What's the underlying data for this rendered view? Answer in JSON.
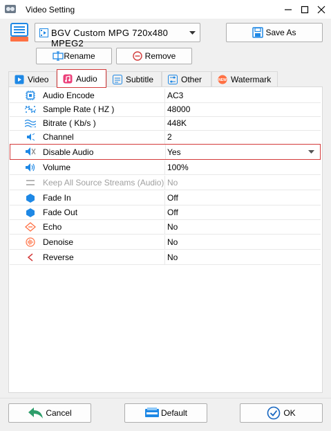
{
  "window": {
    "title": "Video Setting"
  },
  "preset": {
    "selected": "BGV Custom MPG 720x480 MPEG2"
  },
  "buttons": {
    "save_as": "Save As",
    "rename": "Rename",
    "remove": "Remove",
    "cancel": "Cancel",
    "default": "Default",
    "ok": "OK"
  },
  "tabs": [
    {
      "label": "Video",
      "icon": "video-icon"
    },
    {
      "label": "Audio",
      "icon": "music-note-icon"
    },
    {
      "label": "Subtitle",
      "icon": "subtitle-icon"
    },
    {
      "label": "Other",
      "icon": "sliders-icon"
    },
    {
      "label": "Watermark",
      "icon": "new-badge-icon"
    }
  ],
  "active_tab": "Audio",
  "properties": [
    {
      "name": "Audio Encode",
      "value": "AC3",
      "icon": "chip-icon"
    },
    {
      "name": "Sample Rate ( HZ )",
      "value": "48000",
      "icon": "sample-rate-icon"
    },
    {
      "name": "Bitrate ( Kb/s )",
      "value": "448K",
      "icon": "wave-icon"
    },
    {
      "name": "Channel",
      "value": "2",
      "icon": "channel-icon"
    },
    {
      "name": "Disable Audio",
      "value": "Yes",
      "icon": "speaker-muted-icon",
      "selected": true
    },
    {
      "name": "Volume",
      "value": "100%",
      "icon": "speaker-icon"
    },
    {
      "name": "Keep All Source Streams (Audio)",
      "value": "No",
      "icon": "lines-icon",
      "disabled": true
    },
    {
      "name": "Fade In",
      "value": "Off",
      "icon": "hexagon-icon"
    },
    {
      "name": "Fade Out",
      "value": "Off",
      "icon": "hexagon-icon"
    },
    {
      "name": "Echo",
      "value": "No",
      "icon": "echo-icon"
    },
    {
      "name": "Denoise",
      "value": "No",
      "icon": "denoise-icon"
    },
    {
      "name": "Reverse",
      "value": "No",
      "icon": "reverse-icon"
    }
  ],
  "colors": {
    "accent_red": "#d33a3a",
    "icon_blue": "#1e88e5",
    "ok_blue": "#1565c0",
    "cancel_green": "#2e9e6b"
  }
}
